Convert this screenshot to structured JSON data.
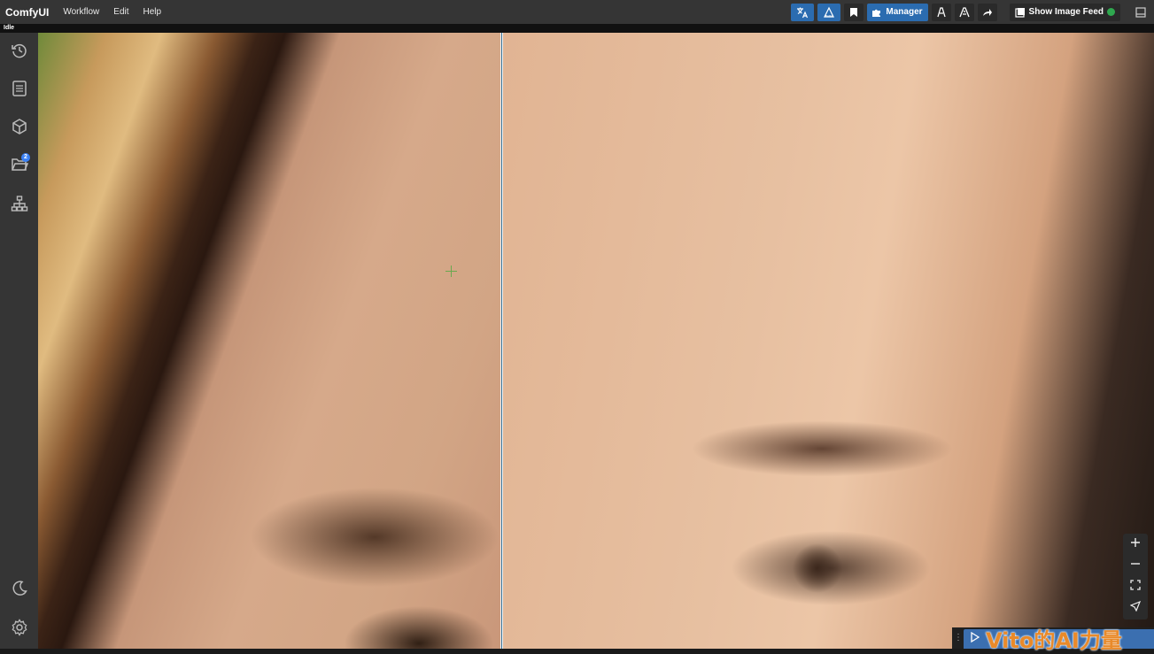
{
  "app": {
    "brand": "ComfyUI"
  },
  "menu": {
    "items": [
      "Workflow",
      "Edit",
      "Help"
    ]
  },
  "toolbar": {
    "manager_label": "Manager",
    "image_feed_label": "Show Image Feed"
  },
  "status": {
    "text": "Idle"
  },
  "sidebar": {
    "items": [
      {
        "icon": "history-icon"
      },
      {
        "icon": "queue-list-icon"
      },
      {
        "icon": "model-library-icon"
      },
      {
        "icon": "workflows-folder-icon",
        "badge": "2"
      },
      {
        "icon": "node-library-icon"
      }
    ],
    "bottom": [
      {
        "icon": "moon-icon"
      },
      {
        "icon": "settings-gear-icon"
      }
    ]
  },
  "zoom_controls": [
    "zoom-in-icon",
    "zoom-out-icon",
    "fit-view-icon",
    "locate-icon"
  ],
  "watermark": {
    "text": "Vito的AI力量"
  },
  "colors": {
    "topbar": "#353535",
    "accent": "#2b6cb0",
    "sidebar": "#353535",
    "feed_status": "#2fa84f"
  }
}
